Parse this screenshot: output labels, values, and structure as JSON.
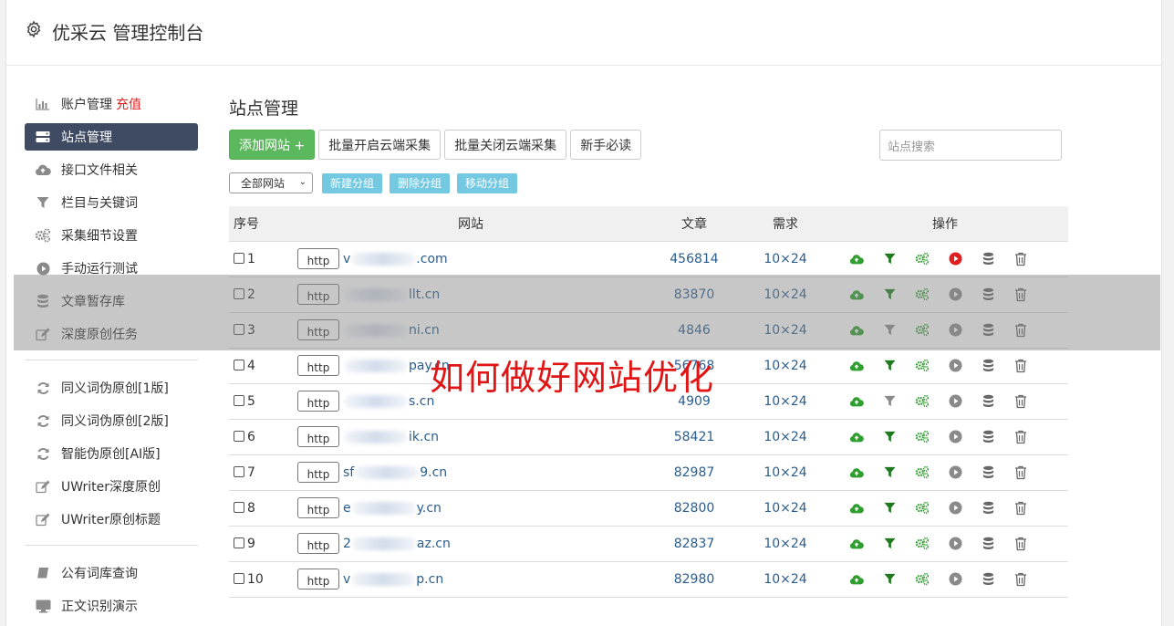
{
  "app": {
    "title": "优采云 管理控制台",
    "icon": "gear-icon"
  },
  "sidebar": {
    "groups": [
      [
        {
          "label": "账户管理",
          "badge": "充值",
          "icon": "bar-chart-icon"
        },
        {
          "label": "站点管理",
          "icon": "server-icon",
          "active": true
        },
        {
          "label": "接口文件相关",
          "icon": "cloud-upload-icon"
        },
        {
          "label": "栏目与关键词",
          "icon": "filter-icon"
        },
        {
          "label": "采集细节设置",
          "icon": "gears-icon"
        },
        {
          "label": "手动运行测试",
          "icon": "play-circle-icon"
        },
        {
          "label": "文章暂存库",
          "icon": "database-icon"
        },
        {
          "label": "深度原创任务",
          "icon": "edit-icon"
        }
      ],
      [
        {
          "label": "同义词伪原创[1版]",
          "icon": "refresh-icon"
        },
        {
          "label": "同义词伪原创[2版]",
          "icon": "refresh-icon"
        },
        {
          "label": "智能伪原创[AI版]",
          "icon": "refresh-icon"
        },
        {
          "label": "UWriter深度原创",
          "icon": "edit-icon"
        },
        {
          "label": "UWriter原创标题",
          "icon": "edit-icon"
        }
      ],
      [
        {
          "label": "公有词库查询",
          "icon": "book-icon"
        },
        {
          "label": "正文识别演示",
          "icon": "monitor-icon"
        }
      ]
    ]
  },
  "main": {
    "title": "站点管理",
    "toolbar": {
      "add_site": "添加网站 +",
      "batch_open": "批量开启云端采集",
      "batch_close": "批量关闭云端采集",
      "guide": "新手必读"
    },
    "search": {
      "placeholder": "站点搜索"
    },
    "group_select": "全部网站",
    "group_buttons": {
      "new": "新建分组",
      "delete": "删除分组",
      "move": "移动分组"
    },
    "table": {
      "headers": {
        "no": "序号",
        "site": "网站",
        "articles": "文章",
        "demand": "需求",
        "ops": "操作"
      },
      "rows": [
        {
          "no": "1",
          "proto": "http",
          "prefix": "v",
          "suffix": ".com",
          "articles": "456814",
          "demand": "10×24",
          "filter_active": true,
          "play_active": true
        },
        {
          "no": "2",
          "proto": "http",
          "prefix": "",
          "suffix": "llt.cn",
          "articles": "83870",
          "demand": "10×24",
          "filter_active": true,
          "play_active": false
        },
        {
          "no": "3",
          "proto": "http",
          "prefix": "",
          "suffix": "ni.cn",
          "articles": "4846",
          "demand": "10×24",
          "filter_active": false,
          "play_active": false
        },
        {
          "no": "4",
          "proto": "http",
          "prefix": "",
          "suffix": "pay.cn",
          "articles": "56768",
          "demand": "10×24",
          "filter_active": true,
          "play_active": false
        },
        {
          "no": "5",
          "proto": "http",
          "prefix": "",
          "suffix": "s.cn",
          "articles": "4909",
          "demand": "10×24",
          "filter_active": false,
          "play_active": false
        },
        {
          "no": "6",
          "proto": "http",
          "prefix": "",
          "suffix": "ik.cn",
          "articles": "58421",
          "demand": "10×24",
          "filter_active": true,
          "play_active": false
        },
        {
          "no": "7",
          "proto": "http",
          "prefix": "sf",
          "suffix": "9.cn",
          "articles": "82987",
          "demand": "10×24",
          "filter_active": true,
          "play_active": false
        },
        {
          "no": "8",
          "proto": "http",
          "prefix": "e",
          "suffix": "y.cn",
          "articles": "82800",
          "demand": "10×24",
          "filter_active": true,
          "play_active": false
        },
        {
          "no": "9",
          "proto": "http",
          "prefix": "2",
          "suffix": "az.cn",
          "articles": "82837",
          "demand": "10×24",
          "filter_active": true,
          "play_active": false
        },
        {
          "no": "10",
          "proto": "http",
          "prefix": "v",
          "suffix": "p.cn",
          "articles": "82980",
          "demand": "10×24",
          "filter_active": true,
          "play_active": false
        }
      ]
    }
  },
  "watermark": "如何做好网站优化",
  "colors": {
    "green": "#2e9e2e",
    "red": "#e02020",
    "link": "#2a5d8f",
    "active_nav": "#3e4b63"
  }
}
